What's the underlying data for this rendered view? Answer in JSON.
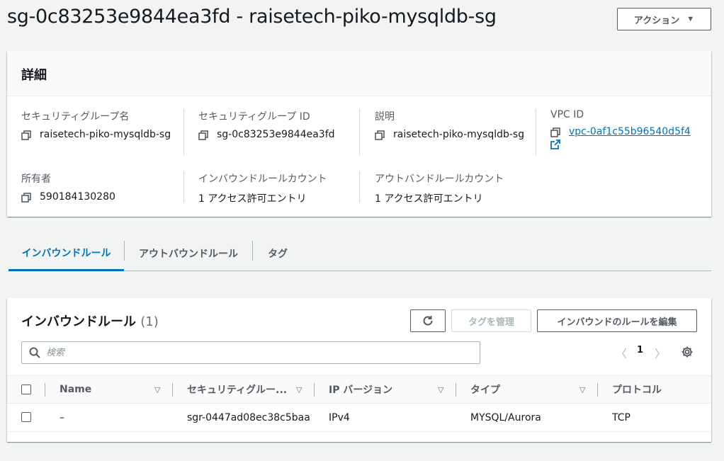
{
  "header": {
    "title": "sg-0c83253e9844ea3fd - raisetech-piko-mysqldb-sg",
    "actions_label": "アクション"
  },
  "details": {
    "heading": "詳細",
    "sg_name_label": "セキュリティグループ名",
    "sg_name_value": "raisetech-piko-mysqldb-sg",
    "sg_id_label": "セキュリティグループ ID",
    "sg_id_value": "sg-0c83253e9844ea3fd",
    "description_label": "説明",
    "description_value": "raisetech-piko-mysqldb-sg",
    "vpc_label": "VPC ID",
    "vpc_value": "vpc-0af1c55b96540d5f4",
    "owner_label": "所有者",
    "owner_value": "590184130280",
    "inbound_count_label": "インバウンドルールカウント",
    "inbound_count_value": "1 アクセス許可エントリ",
    "outbound_count_label": "アウトバンドルールカウント",
    "outbound_count_value": "1 アクセス許可エントリ"
  },
  "tabs": [
    {
      "label": "インバウンドルール",
      "active": true
    },
    {
      "label": "アウトバウンドルール",
      "active": false
    },
    {
      "label": "タグ",
      "active": false
    }
  ],
  "rules": {
    "title": "インバウンドルール",
    "count": "(1)",
    "manage_tags_label": "タグを管理",
    "edit_label": "インバウンドのルールを編集",
    "search_placeholder": "検索",
    "page": "1",
    "columns": [
      "Name",
      "セキュリティグルー...",
      "IP バージョン",
      "タイプ",
      "プロトコル"
    ],
    "rows": [
      {
        "name": "–",
        "sgr_id": "sgr-0447ad08ec38c5baa",
        "ip_version": "IPv4",
        "type": "MYSQL/Aurora",
        "protocol": "TCP"
      }
    ]
  },
  "colors": {
    "link": "#0073bb",
    "text": "#16191f",
    "secondary": "#545b64",
    "background": "#f2f3f3"
  }
}
